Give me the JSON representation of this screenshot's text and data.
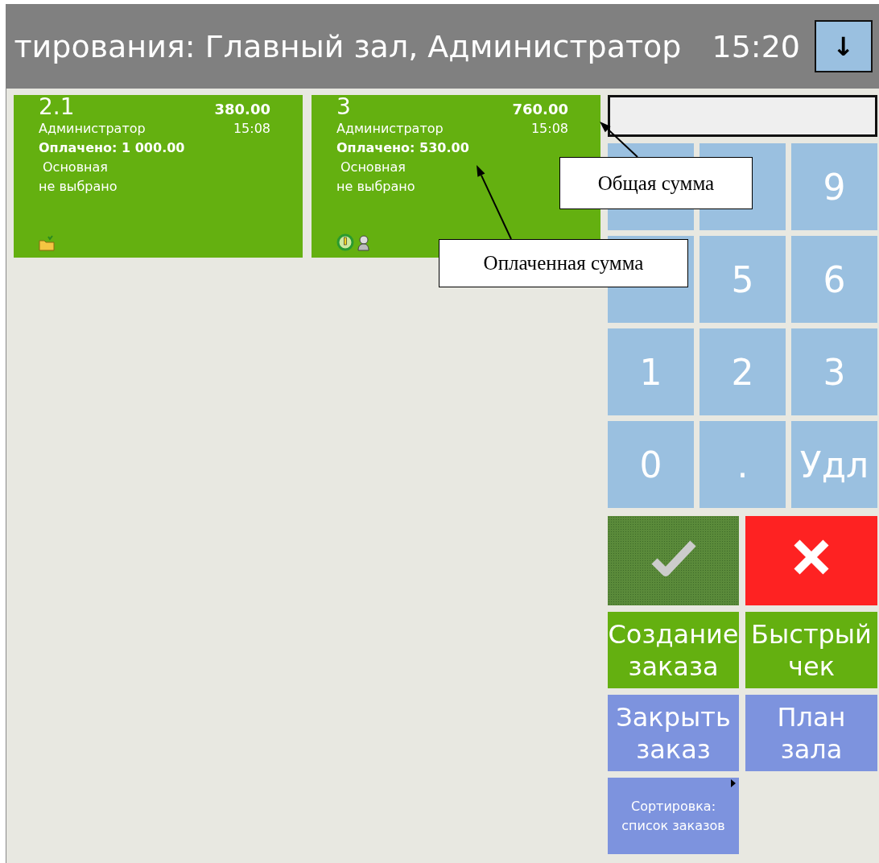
{
  "header": {
    "title": "тирования: Главный зал, Администратор",
    "time": "15:20",
    "menu_button": "↓"
  },
  "orders": [
    {
      "number": "2.1",
      "total": "380.00",
      "waiter": "Администратор",
      "time": "15:08",
      "paid": "Оплачено: 1 000.00",
      "hall": "Основная",
      "table": "не выбрано",
      "icons": [
        {
          "kind": "folder"
        }
      ]
    },
    {
      "number": "3",
      "total": "760.00",
      "waiter": "Администратор",
      "time": "15:08",
      "paid": "Оплачено: 530.00",
      "hall": "Основная",
      "table": "не выбрано",
      "icons": [
        {
          "kind": "power"
        },
        {
          "kind": "figure"
        }
      ]
    }
  ],
  "keypad": [
    {
      "kind": "covered"
    },
    {
      "kind": "covered"
    },
    {
      "kind": "digit",
      "label": "9"
    },
    {
      "kind": "covered"
    },
    {
      "kind": "digit",
      "label": "5"
    },
    {
      "kind": "digit",
      "label": "6"
    },
    {
      "kind": "digit",
      "label": "1"
    },
    {
      "kind": "digit",
      "label": "2"
    },
    {
      "kind": "digit",
      "label": "3"
    },
    {
      "kind": "digit",
      "label": "0"
    },
    {
      "kind": "digit",
      "label": "."
    },
    {
      "kind": "digit",
      "label": "Удл"
    }
  ],
  "actions": [
    {
      "kind": "confirm",
      "disabled": true
    },
    {
      "kind": "cancel",
      "disabled": false
    },
    {
      "kind": "green",
      "label": "Создание заказа"
    },
    {
      "kind": "green",
      "label": "Быстрый чек"
    },
    {
      "kind": "blue",
      "label": "Закрыть заказ"
    },
    {
      "kind": "blue",
      "label": "План зала"
    },
    {
      "kind": "menu",
      "label": "Сортировка: список заказов"
    }
  ],
  "callouts": [
    {
      "text": "Общая сумма"
    },
    {
      "text": "Оплаченная сумма"
    }
  ]
}
